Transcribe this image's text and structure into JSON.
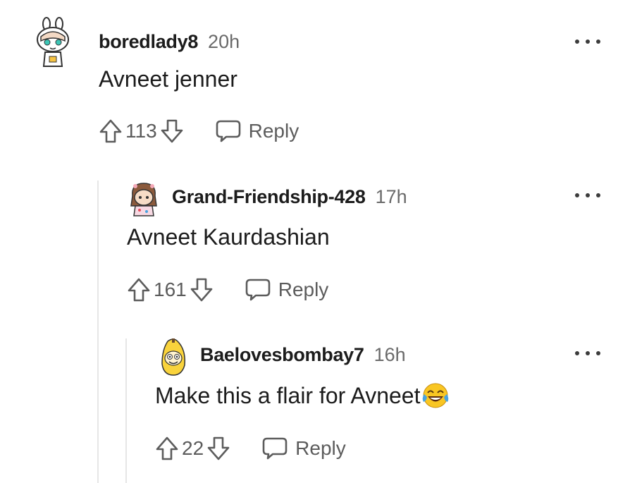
{
  "comments": [
    {
      "username": "boredlady8",
      "time": "20h",
      "text": "Avneet jenner",
      "score": "113",
      "reply_label": "Reply",
      "avatar_icon": "snoo-bunny-hat-avatar"
    },
    {
      "username": "Grand-Friendship-428",
      "time": "17h",
      "text": "Avneet Kaurdashian",
      "score": "161",
      "reply_label": "Reply",
      "avatar_icon": "snoo-brown-hair-avatar"
    },
    {
      "username": "Baelovesbombay7",
      "time": "16h",
      "text": "Make this a flair for Avneet",
      "text_emoji": "face-with-tears-of-joy",
      "score": "22",
      "reply_label": "Reply",
      "avatar_icon": "snoo-banana-costume-avatar"
    }
  ],
  "colors": {
    "text": "#1c1c1c",
    "muted": "#6a6a6a",
    "thread_line": "#e6e6e6",
    "emoji_face": "#f9c623"
  }
}
